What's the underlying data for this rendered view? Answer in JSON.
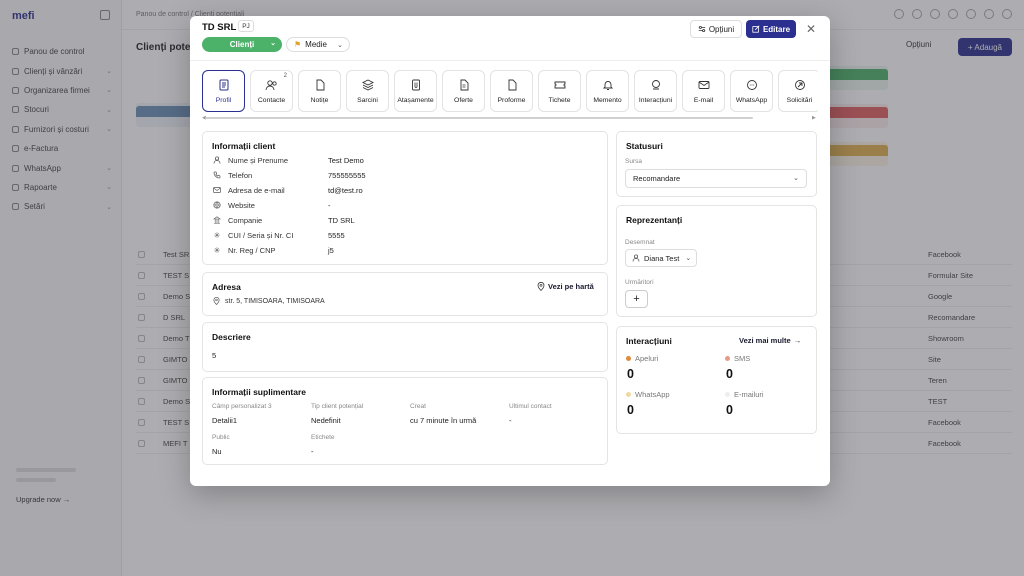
{
  "background": {
    "logo": "mefi",
    "breadcrumb": "Panou de control / Clienți potențiali",
    "page_title": "Clienți pote",
    "options_label": "Opțiuni",
    "add_label": "+ Adaugă",
    "upgrade_label": "Upgrade now →",
    "nav": [
      "Panou de control",
      "Clienți și vânzări",
      "Organizarea firmei",
      "Stocuri",
      "Furnizori și costuri",
      "e-Factura",
      "WhatsApp",
      "Rapoarte",
      "Setări"
    ],
    "rows": [
      {
        "name": "Test SR",
        "source": "Facebook"
      },
      {
        "name": "TEST S",
        "source": "Formular Site"
      },
      {
        "name": "Demo S",
        "source": "Google"
      },
      {
        "name": "D SRL",
        "source": "Recomandare"
      },
      {
        "name": "Demo T",
        "source": "Showroom"
      },
      {
        "name": "GIMTO",
        "source": "Site"
      },
      {
        "name": "GIMTO",
        "source": "Teren"
      },
      {
        "name": "Demo S",
        "source": "TEST"
      },
      {
        "name": "TEST S",
        "source": "Facebook"
      },
      {
        "name": "MEFI T",
        "source": "Facebook"
      }
    ]
  },
  "modal": {
    "client_name": "TD SRL",
    "client_type": "PJ",
    "status_label": "Clienți",
    "priority_label": "Medie",
    "options_label": "Opțiuni",
    "edit_label": "Editare",
    "tabs": [
      {
        "label": "Profil",
        "icon": "profile-icon",
        "active": true
      },
      {
        "label": "Contacte",
        "icon": "contacts-icon",
        "count": "2"
      },
      {
        "label": "Notițe",
        "icon": "notes-icon"
      },
      {
        "label": "Sarcini",
        "icon": "tasks-icon"
      },
      {
        "label": "Atașamente",
        "icon": "attachments-icon"
      },
      {
        "label": "Oferte",
        "icon": "offers-icon"
      },
      {
        "label": "Proforme",
        "icon": "proforma-icon"
      },
      {
        "label": "Tichete",
        "icon": "tickets-icon"
      },
      {
        "label": "Memento",
        "icon": "bell-icon"
      },
      {
        "label": "Interacțiuni",
        "icon": "interactions-icon"
      },
      {
        "label": "E-mail",
        "icon": "mail-icon"
      },
      {
        "label": "WhatsApp",
        "icon": "whatsapp-icon"
      },
      {
        "label": "Solicitări",
        "icon": "requests-icon"
      }
    ],
    "client_info": {
      "title": "Informații client",
      "rows": [
        {
          "label": "Nume și Prenume",
          "value": "Test Demo",
          "icon": "user-icon"
        },
        {
          "label": "Telefon",
          "value": "755555555",
          "icon": "phone-icon"
        },
        {
          "label": "Adresa de e-mail",
          "value": "td@test.ro",
          "icon": "mail-icon"
        },
        {
          "label": "Website",
          "value": "-",
          "icon": "globe-icon"
        },
        {
          "label": "Companie",
          "value": "TD SRL",
          "icon": "building-icon"
        },
        {
          "label": "CUI / Seria și Nr. CI",
          "value": "5555",
          "icon": "asterisk-icon"
        },
        {
          "label": "Nr. Reg / CNP",
          "value": "j5",
          "icon": "asterisk-icon"
        }
      ]
    },
    "address": {
      "title": "Adresa",
      "map_link": "Vezi pe hartă",
      "value": "str. 5, TIMISOARA, TIMISOARA"
    },
    "description": {
      "title": "Descriere",
      "value": "5"
    },
    "extra": {
      "title": "Informații suplimentare",
      "fields": [
        {
          "label": "Câmp personalizat 3",
          "value": "Detalii1"
        },
        {
          "label": "Tip client potențial",
          "value": "Nedefinit"
        },
        {
          "label": "Creat",
          "value": "cu 7 minute în urmă"
        },
        {
          "label": "Ultimul contact",
          "value": "-"
        },
        {
          "label": "Public",
          "value": "Nu"
        },
        {
          "label": "Etichete",
          "value": "-"
        }
      ]
    },
    "statuses": {
      "title": "Statusuri",
      "source_label": "Sursa",
      "source_value": "Recomandare"
    },
    "reps": {
      "title": "Reprezentanți",
      "assigned_label": "Desemnat",
      "assigned_value": "Diana Test",
      "followers_label": "Urmăritori"
    },
    "interactions": {
      "title": "Interacțiuni",
      "more_link": "Vezi mai multe",
      "stats": [
        {
          "label": "Apeluri",
          "value": "0",
          "color": "#e08a3c"
        },
        {
          "label": "SMS",
          "value": "0",
          "color": "#e59a8a"
        },
        {
          "label": "WhatsApp",
          "value": "0",
          "color": "#f0d8a0"
        },
        {
          "label": "E-mailuri",
          "value": "0",
          "color": "#eeeeee"
        }
      ]
    }
  }
}
